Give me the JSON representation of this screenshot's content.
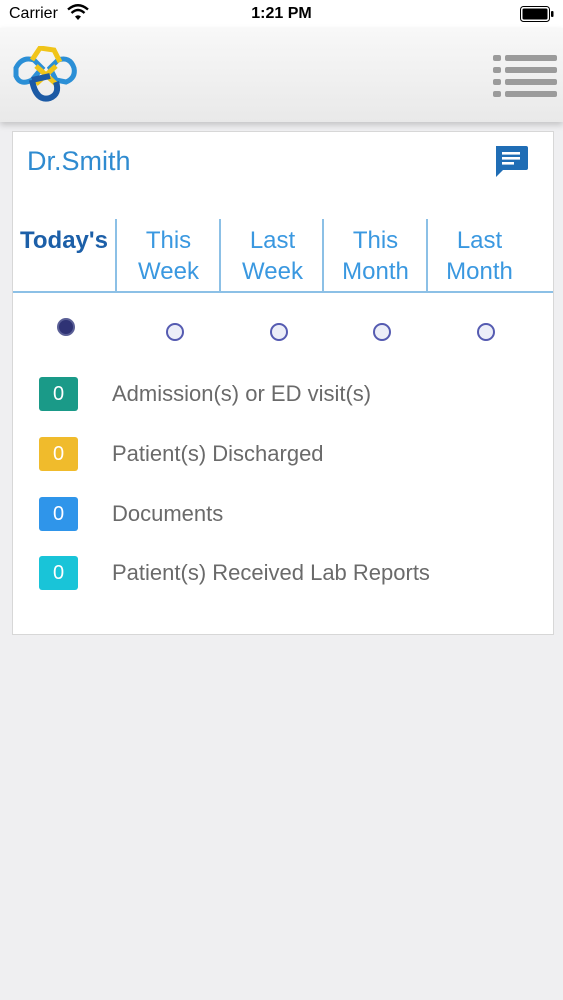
{
  "status_bar": {
    "carrier": "Carrier",
    "time": "1:21 PM"
  },
  "header": {
    "logo_icon": "app-logo",
    "menu_icon": "list-menu-icon"
  },
  "card": {
    "doctor_name": "Dr.Smith",
    "message_icon": "chat-bubble-icon",
    "tabs": [
      {
        "line1": "Today's",
        "line2": "",
        "selected": true
      },
      {
        "line1": "This",
        "line2": "Week",
        "selected": false
      },
      {
        "line1": "Last",
        "line2": "Week",
        "selected": false
      },
      {
        "line1": "This",
        "line2": "Month",
        "selected": false
      },
      {
        "line1": "Last",
        "line2": "Month",
        "selected": false
      }
    ],
    "stats": [
      {
        "count": "0",
        "label": "Admission(s) or ED visit(s)",
        "color": "#1a9a88"
      },
      {
        "count": "0",
        "label": "Patient(s) Discharged",
        "color": "#f0bb2c"
      },
      {
        "count": "0",
        "label": "Documents",
        "color": "#2f95ea"
      },
      {
        "count": "0",
        "label": "Patient(s) Received Lab Reports",
        "color": "#19c4d8"
      }
    ]
  },
  "colors": {
    "accent": "#2f8bd0",
    "tab_active": "#1c5fa8",
    "tab_inactive": "#3a98e0",
    "background": "#efeff1"
  }
}
